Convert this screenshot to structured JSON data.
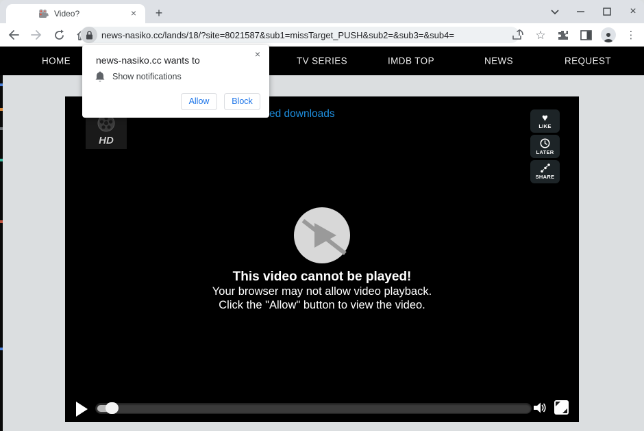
{
  "browser": {
    "tab_title": "Video?",
    "url": "news-nasiko.cc/lands/18/?site=8021587&sub1=missTarget_PUSH&sub2=&sub3=&sub4=",
    "close_glyph": "×",
    "newtab_glyph": "+",
    "kebab_glyph": "⋮",
    "star_glyph": "☆"
  },
  "navbar": {
    "items": [
      {
        "label": "HOME"
      },
      {
        "label": "TV SERIES"
      },
      {
        "label": "IMDB TOP"
      },
      {
        "label": "NEWS"
      },
      {
        "label": "REQUEST"
      }
    ]
  },
  "popup": {
    "title": "news-nasiko.cc wants to",
    "permission": "Show notifications",
    "allow_label": "Allow",
    "block_label": "Block",
    "close_glyph": "×"
  },
  "player": {
    "link_text_visible": "ed downloads",
    "hd_label": "HD",
    "actions": [
      {
        "label": "LIKE",
        "icon": "heart",
        "heart_glyph": "♥"
      },
      {
        "label": "LATER",
        "icon": "clock"
      },
      {
        "label": "SHARE",
        "icon": "share-nodes"
      }
    ],
    "error_title": "This video cannot be played!",
    "error_line1": "Your browser may not allow video playback.",
    "error_line2": "Click the \"Allow\" button to view the video."
  },
  "colors": {
    "accent_blue": "#1a73e8",
    "link_blue": "#1e8fe0",
    "nav_bg": "#000000",
    "page_bg": "#dbdee0",
    "tabbar_bg": "#dee1e6"
  }
}
